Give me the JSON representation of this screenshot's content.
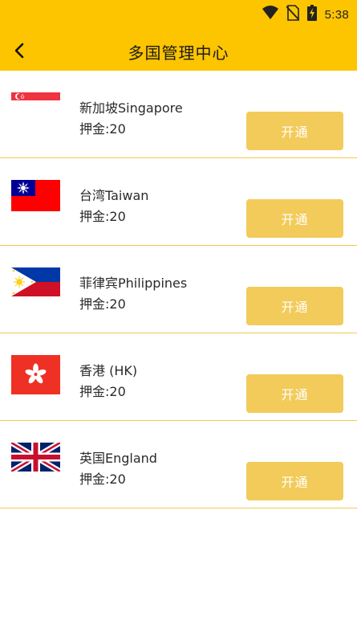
{
  "status_bar": {
    "time": "5:38",
    "icons": [
      "wifi-icon",
      "no-sim-icon",
      "battery-charging-icon"
    ]
  },
  "app_bar": {
    "title": "多国管理中心",
    "back_icon": "chevron-left-icon"
  },
  "countries": [
    {
      "name": "新加坡Singapore",
      "deposit": "押金:20",
      "button": "开通",
      "flag": "flag-singapore-icon"
    },
    {
      "name": "台湾Taiwan",
      "deposit": "押金:20",
      "button": "开通",
      "flag": "flag-taiwan-icon"
    },
    {
      "name": "菲律宾Philippines",
      "deposit": "押金:20",
      "button": "开通",
      "flag": "flag-philippines-icon"
    },
    {
      "name": "香港 (HK)",
      "deposit": "押金:20",
      "button": "开通",
      "flag": "flag-hongkong-icon"
    },
    {
      "name": "英国England",
      "deposit": "押金:20",
      "button": "开通",
      "flag": "flag-uk-icon"
    }
  ],
  "colors": {
    "accent": "#FDC400",
    "button": "#F2CB5A",
    "divider": "#F4C94F"
  }
}
